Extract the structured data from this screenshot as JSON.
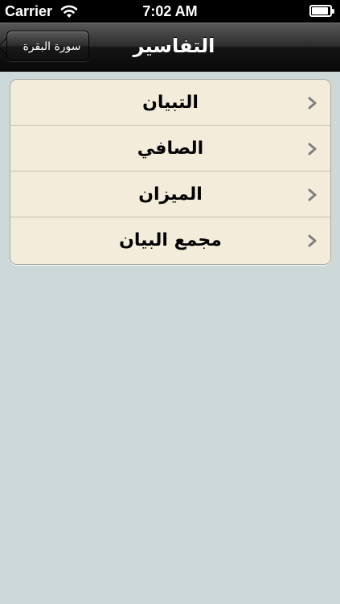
{
  "status_bar": {
    "carrier": "Carrier",
    "time": "7:02 AM",
    "wifi_icon": "wifi-icon",
    "battery_icon": "battery-icon",
    "battery_level": 0.9
  },
  "nav": {
    "title": "التفاسير",
    "back_label": "سورة البقرة"
  },
  "list": {
    "items": [
      {
        "label": "التبيان"
      },
      {
        "label": "الصافي"
      },
      {
        "label": "الميزان"
      },
      {
        "label": "مجمع البيان"
      }
    ],
    "chevron_icon": "chevron-right-icon"
  },
  "colors": {
    "background": "#cdd9d9",
    "cell": "#f3ecda",
    "chevron": "#7f7f7f"
  }
}
